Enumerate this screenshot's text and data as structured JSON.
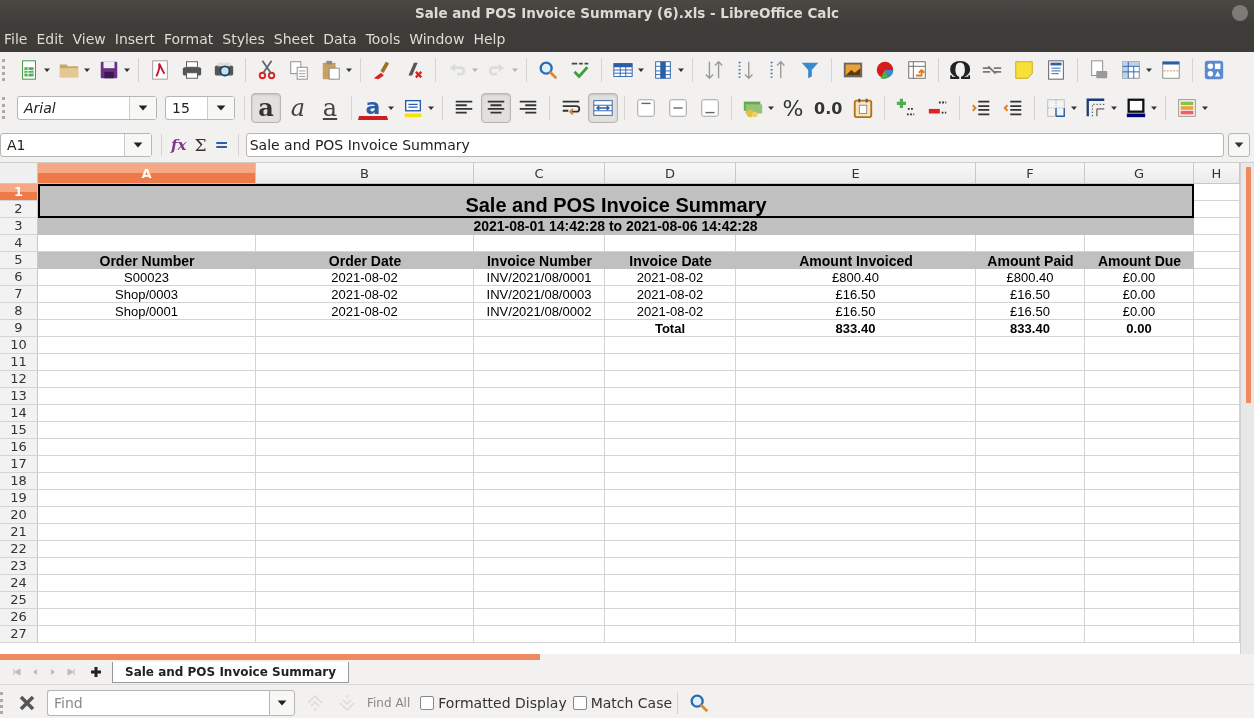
{
  "window": {
    "title": "Sale and POS Invoice Summary (6).xls - LibreOffice Calc"
  },
  "menu": [
    "File",
    "Edit",
    "View",
    "Insert",
    "Format",
    "Styles",
    "Sheet",
    "Data",
    "Tools",
    "Window",
    "Help"
  ],
  "history": {
    "undo_disabled": true,
    "redo_disabled": true
  },
  "font_name": {
    "value": "Arial"
  },
  "font_size": {
    "value": "15"
  },
  "text_style_buttons": [
    {
      "kind": "bold",
      "label": "a",
      "on": true
    },
    {
      "kind": "italic",
      "label": "a",
      "on": false
    },
    {
      "kind": "underline",
      "label": "a",
      "on": false
    }
  ],
  "font_color_label": "a",
  "align_buttons": [
    {
      "kind": "left",
      "on": false
    },
    {
      "kind": "center",
      "on": true
    },
    {
      "kind": "right",
      "on": false
    }
  ],
  "wrap_on": false,
  "merge_on": true,
  "number_format_labels": {
    "percent": "%",
    "decimal": "0.0"
  },
  "special_character_label": "Ω",
  "name_box": {
    "value": "A1"
  },
  "formula_buttons": [
    "fx",
    "Σ",
    "="
  ],
  "formula": {
    "value": "Sale and POS Invoice Summary"
  },
  "columns": [
    {
      "label": "A",
      "selected": true
    },
    {
      "label": "B",
      "selected": false
    },
    {
      "label": "C",
      "selected": false
    },
    {
      "label": "D",
      "selected": false
    },
    {
      "label": "E",
      "selected": false
    },
    {
      "label": "F",
      "selected": false
    },
    {
      "label": "G",
      "selected": false
    },
    {
      "label": "H",
      "selected": false
    }
  ],
  "row_numbers": [
    {
      "label": "1",
      "selected": true
    },
    {
      "label": "2",
      "selected": false
    },
    {
      "label": "3",
      "selected": false
    },
    {
      "label": "4",
      "selected": false
    },
    {
      "label": "5",
      "selected": false
    },
    {
      "label": "6",
      "selected": false
    },
    {
      "label": "7",
      "selected": false
    },
    {
      "label": "8",
      "selected": false
    },
    {
      "label": "9",
      "selected": false
    },
    {
      "label": "10",
      "selected": false
    },
    {
      "label": "11",
      "selected": false
    },
    {
      "label": "12",
      "selected": false
    },
    {
      "label": "13",
      "selected": false
    },
    {
      "label": "14",
      "selected": false
    },
    {
      "label": "15",
      "selected": false
    },
    {
      "label": "16",
      "selected": false
    },
    {
      "label": "17",
      "selected": false
    },
    {
      "label": "18",
      "selected": false
    },
    {
      "label": "19",
      "selected": false
    },
    {
      "label": "20",
      "selected": false
    },
    {
      "label": "21",
      "selected": false
    },
    {
      "label": "22",
      "selected": false
    },
    {
      "label": "23",
      "selected": false
    },
    {
      "label": "24",
      "selected": false
    },
    {
      "label": "25",
      "selected": false
    },
    {
      "label": "26",
      "selected": false
    },
    {
      "label": "27",
      "selected": false
    }
  ],
  "sheet": {
    "title": "Sale and POS Invoice Summary",
    "subtitle": "2021-08-01 14:42:28 to 2021-08-06 14:42:28",
    "headers": [
      "Order Number",
      "Order Date",
      "Invoice Number",
      "Invoice Date",
      "Amount Invoiced",
      "Amount Paid",
      "Amount Due"
    ],
    "records": [
      [
        "S00023",
        "2021-08-02",
        "INV/2021/08/0001",
        "2021-08-02",
        "£800.40",
        "£800.40",
        "£0.00"
      ],
      [
        "Shop/0003",
        "2021-08-02",
        "INV/2021/08/0003",
        "2021-08-02",
        "£16.50",
        "£16.50",
        "£0.00"
      ],
      [
        "Shop/0001",
        "2021-08-02",
        "INV/2021/08/0002",
        "2021-08-02",
        "£16.50",
        "£16.50",
        "£0.00"
      ]
    ],
    "totals": [
      "Total",
      "833.40",
      "833.40",
      "0.00"
    ]
  },
  "sheet_tabs": [
    {
      "label": "Sale and POS Invoice Summary",
      "selected": true
    }
  ],
  "find_bar": {
    "placeholder": "Find",
    "find_all": "Find All",
    "navigation_disabled": true,
    "options": [
      {
        "label": "Formatted Display",
        "checked": false
      },
      {
        "label": "Match Case",
        "checked": false
      }
    ]
  }
}
